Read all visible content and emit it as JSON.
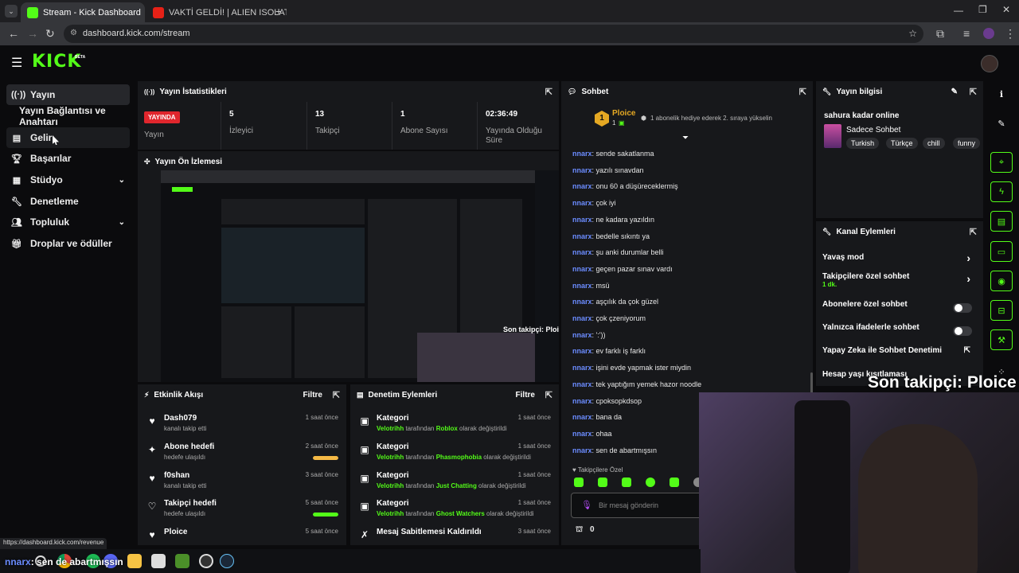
{
  "browser": {
    "tabs": [
      {
        "title": "Stream - Kick Dashboard",
        "active": true
      },
      {
        "title": "VAKTİ GELDİ! | ALIEN ISOLATIO",
        "active": false
      }
    ],
    "url": "dashboard.kick.com/stream",
    "status_url": "https://dashboard.kick.com/revenue"
  },
  "header": {
    "logo": "KICK",
    "beta": "BETA"
  },
  "sidebar": {
    "items": [
      {
        "label": "Yayın",
        "icon": "broadcast-icon"
      },
      {
        "label": "Yayın Bağlantısı ve Anahtarı",
        "icon": ""
      },
      {
        "label": "Gelir",
        "icon": "revenue-icon"
      },
      {
        "label": "Başarılar",
        "icon": "trophy-icon"
      },
      {
        "label": "Stüdyo",
        "icon": "studio-icon"
      },
      {
        "label": "Denetleme",
        "icon": "wrench-icon"
      },
      {
        "label": "Topluluk",
        "icon": "community-icon"
      },
      {
        "label": "Droplar ve ödüller",
        "icon": "gift-icon"
      }
    ]
  },
  "stats": {
    "title": "Yayın İstatistikleri",
    "live_badge": "YAYINDA",
    "live_label": "Yayın",
    "cells": [
      {
        "value": "5",
        "label": "İzleyici"
      },
      {
        "value": "13",
        "label": "Takipçi"
      },
      {
        "value": "1",
        "label": "Abone Sayısı"
      },
      {
        "value": "02:36:49",
        "label": "Yayında Olduğu Süre"
      }
    ]
  },
  "preview": {
    "title": "Yayın Ön İzlemesi",
    "overlay": "Son takipçi: Ploice"
  },
  "activity": {
    "title": "Etkinlik Akışı",
    "filter": "Filtre",
    "rows": [
      {
        "title": "Dash079",
        "sub": "kanalı takip etti",
        "time": "1 saat önce",
        "icon": "heart-icon"
      },
      {
        "title": "Abone hedefi",
        "sub": "hedefe ulaşıldı",
        "time": "2 saat önce",
        "icon": "sparkle-icon",
        "progress": 1.0,
        "color": "#f5b945"
      },
      {
        "title": "f0shan",
        "sub": "kanalı takip etti",
        "time": "3 saat önce",
        "icon": "heart-icon"
      },
      {
        "title": "Takipçi hedefi",
        "sub": "hedefe ulaşıldı",
        "time": "5 saat önce",
        "icon": "heart-outline-icon",
        "progress": 1.0,
        "color": "#53fc18"
      },
      {
        "title": "Ploice",
        "sub": "",
        "time": "5 saat önce",
        "icon": "heart-icon"
      }
    ]
  },
  "moderation": {
    "title": "Denetim Eylemleri",
    "filter": "Filtre",
    "rows": [
      {
        "title": "Kategori",
        "user": "Velotrihh",
        "mid": " tarafından ",
        "value": "Roblox",
        "end": " olarak değiştirildi",
        "time": "1 saat önce"
      },
      {
        "title": "Kategori",
        "user": "Velotrihh",
        "mid": " tarafından ",
        "value": "Phasmophobia",
        "end": " olarak değiştirildi",
        "time": "1 saat önce"
      },
      {
        "title": "Kategori",
        "user": "Velotrihh",
        "mid": " tarafından ",
        "value": "Just Chatting",
        "end": " olarak değiştirildi",
        "time": "1 saat önce"
      },
      {
        "title": "Kategori",
        "user": "Velotrihh",
        "mid": " tarafından ",
        "value": "Ghost Watchers",
        "end": " olarak değiştirildi",
        "time": "1 saat önce"
      },
      {
        "title": "Mesaj Sabitlemesi Kaldırıldı",
        "user": "",
        "mid": "",
        "value": "",
        "end": "",
        "time": "3 saat önce"
      }
    ]
  },
  "chat": {
    "title": "Sohbet",
    "gifter_name": "Ploice",
    "gifter_rank": "1",
    "gifter_count": "1",
    "gift_msg": "1 abonelik hediye ederek 2. sıraya yükselin",
    "messages": [
      {
        "user": "nnarx",
        "text": ": sende sakatlanma"
      },
      {
        "user": "nnarx",
        "text": ": yazılı sınavdan"
      },
      {
        "user": "nnarx",
        "text": ": onu 60 a düşüreceklermiş"
      },
      {
        "user": "nnarx",
        "text": ": çok iyi"
      },
      {
        "user": "nnarx",
        "text": ": ne kadara yazıldın"
      },
      {
        "user": "nnarx",
        "text": ": bedelle sıkıntı ya"
      },
      {
        "user": "nnarx",
        "text": ": şu anki durumlar belli"
      },
      {
        "user": "nnarx",
        "text": ": geçen pazar sınav vardı"
      },
      {
        "user": "nnarx",
        "text": ": msü"
      },
      {
        "user": "nnarx",
        "text": ": aşçılık da çok güzel"
      },
      {
        "user": "nnarx",
        "text": ": çok çzeniyorum"
      },
      {
        "user": "nnarx",
        "text": ": ':'))"
      },
      {
        "user": "nnarx",
        "text": ": ev farklı iş farklı"
      },
      {
        "user": "nnarx",
        "text": ": işini evde yapmak ister miydin"
      },
      {
        "user": "nnarx",
        "text": ": tek yaptığım yemek hazor noodle"
      },
      {
        "user": "nnarx",
        "text": ": cpoksopkdsop"
      },
      {
        "user": "nnarx",
        "text": ": bana da"
      },
      {
        "user": "nnarx",
        "text": ": ohaa"
      },
      {
        "user": "nnarx",
        "text": ": sen de abartmışsın"
      }
    ],
    "mode_label": "Takipçilere Özel",
    "input_placeholder": "Bir mesaj gönderin",
    "points": "0"
  },
  "stream_info": {
    "title": "Yayın bilgisi",
    "stream_title": "sahura kadar online",
    "category": "Sadece Sohbet",
    "tags": [
      "Turkish",
      "Türkçe",
      "chill",
      "funny"
    ]
  },
  "channel_actions": {
    "title": "Kanal Eylemleri",
    "rows": [
      {
        "label": "Yavaş mod",
        "control": "chevron"
      },
      {
        "label": "Takipçilere özel sohbet",
        "sub": "1 dk.",
        "control": "chevron"
      },
      {
        "label": "Abonelere özel sohbet",
        "control": "toggle"
      },
      {
        "label": "Yalnızca ifadelerle sohbet",
        "control": "toggle"
      },
      {
        "label": "Yapay Zeka ile Sohbet Denetimi",
        "control": "external"
      },
      {
        "label": "Hesap yaşı kısıtlaması",
        "control": "chevron"
      }
    ]
  },
  "webcam_overlay": {
    "follower_text": "Son takipçi: Ploice",
    "chat_user": "nnarx",
    "chat_text": ": sen de abartmışsın"
  },
  "colors": {
    "accent": "#53fc18",
    "live": "#e0262d",
    "username": "#6b8cff",
    "goal_gold": "#f5b945"
  }
}
